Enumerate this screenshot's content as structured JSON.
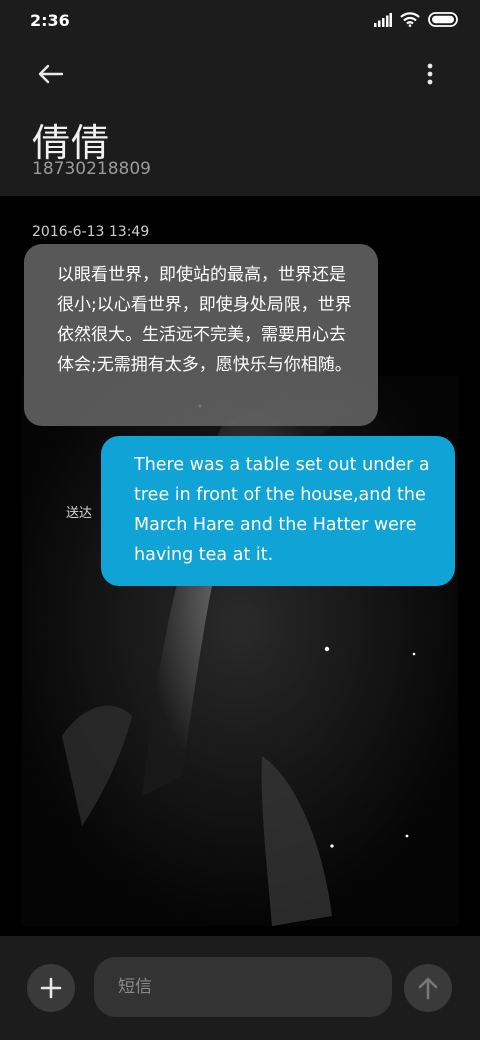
{
  "status_bar": {
    "time": "2:36",
    "icons": [
      "signal-icon",
      "wifi-icon",
      "battery-icon"
    ]
  },
  "header": {
    "back_icon": "arrow-left-icon",
    "more_icon": "more-vertical-icon",
    "contact_name": "倩倩",
    "contact_number": "18730218809"
  },
  "conversation": {
    "timestamp": "2016-6-13 13:49",
    "incoming_message": "以眼看世界，即使站的最高，世界还是很小;以心看世界，即使身处局限，世界依然很大。生活远不完美，需要用心去体会;无需拥有太多，愿快乐与你相随。",
    "outgoing_message": "There was a table set out under a tree in front of the house,and the March Hare and the Hatter were having tea at it.",
    "delivery_status": "送达"
  },
  "composer": {
    "add_icon": "plus-icon",
    "placeholder": "短信",
    "send_icon": "arrow-up-icon"
  },
  "colors": {
    "outgoing_bubble": "#0fa3d6",
    "incoming_bubble": "#646464",
    "header_bg": "#1c1c1c",
    "chat_bg": "#000000"
  }
}
